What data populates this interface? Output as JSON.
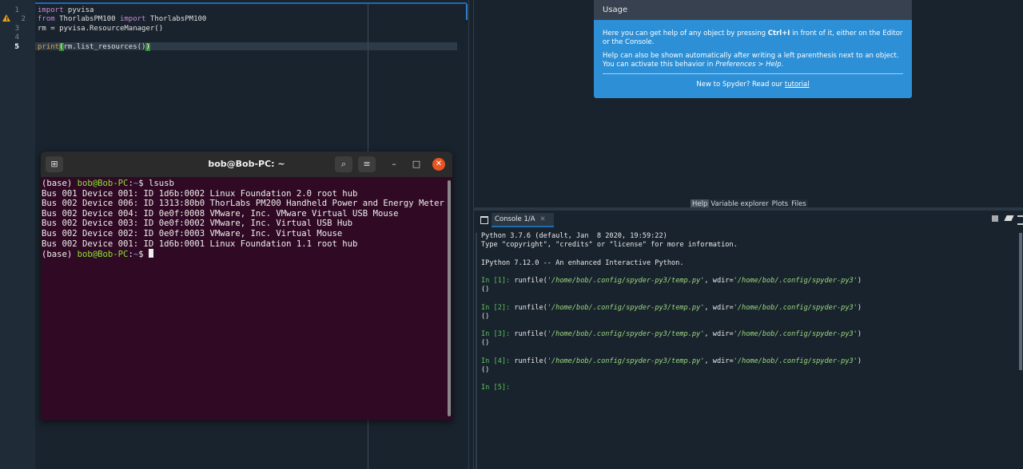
{
  "editor": {
    "line_numbers": [
      "1",
      "2",
      "3",
      "4",
      "5"
    ],
    "warning_glyph": "!",
    "lines": [
      {
        "kw1": "import",
        "t1": " pyvisa"
      },
      {
        "kw1": "from",
        "t1": " ThorlabsPM100 ",
        "kw2": "import",
        "t2": " ThorlabsPM100"
      },
      {
        "t1": "rm = pyvisa.ResourceManager()"
      },
      {
        "t1": ""
      },
      {
        "fn": "print",
        "p_open": "(",
        "mid": "rm.list_resources()",
        "p_close": ")"
      }
    ]
  },
  "terminal": {
    "title": "bob@Bob-PC: ~",
    "icon_new_tab": "⊞",
    "icon_search": "⌕",
    "icon_menu": "≡",
    "icon_minimize": "–",
    "icon_maximize": "□",
    "icon_close": "✕",
    "prompt_prefix": "(base) ",
    "prompt_user": "bob@Bob-PC",
    "prompt_sep": ":",
    "prompt_path": "~",
    "prompt_dollar": "$ ",
    "command": "lsusb",
    "output": [
      "Bus 001 Device 001: ID 1d6b:0002 Linux Foundation 2.0 root hub",
      "Bus 002 Device 006: ID 1313:80b0 ThorLabs PM200 Handheld Power and Energy Meter",
      "Bus 002 Device 004: ID 0e0f:0008 VMware, Inc. VMware Virtual USB Mouse",
      "Bus 002 Device 003: ID 0e0f:0002 VMware, Inc. Virtual USB Hub",
      "Bus 002 Device 002: ID 0e0f:0003 VMware, Inc. Virtual Mouse",
      "Bus 002 Device 001: ID 1d6b:0001 Linux Foundation 1.1 root hub"
    ]
  },
  "usage": {
    "heading": "Usage",
    "p1_a": "Here you can get help of any object by pressing ",
    "p1_b": "Ctrl+I",
    "p1_c": " in front of it, either on the Editor or the Console.",
    "p2_a": "Help can also be shown automatically after writing a left parenthesis next to an object. You can activate this behavior in ",
    "p2_b": "Preferences > Help",
    "p2_c": ".",
    "footer_text": "New to Spyder? Read our ",
    "footer_link": "tutorial"
  },
  "pane_tabs": [
    "Help",
    "Variable explorer",
    "Plots",
    "Files"
  ],
  "console": {
    "tab_label": "Console 1/A",
    "tab_close": "✕",
    "banner": [
      "Python 3.7.6 (default, Jan  8 2020, 19:59:22)",
      "Type \"copyright\", \"credits\" or \"license\" for more information.",
      "",
      "IPython 7.12.0 -- An enhanced Interactive Python."
    ],
    "cells": [
      {
        "prompt": "In [1]: ",
        "call": "runfile(",
        "arg1": "'/home/bob/.config/spyder-py3/temp.py'",
        "mid": ", wdir=",
        "arg2": "'/home/bob/.config/spyder-py3'",
        "end": ")",
        "out": "()"
      },
      {
        "prompt": "In [2]: ",
        "call": "runfile(",
        "arg1": "'/home/bob/.config/spyder-py3/temp.py'",
        "mid": ", wdir=",
        "arg2": "'/home/bob/.config/spyder-py3'",
        "end": ")",
        "out": "()"
      },
      {
        "prompt": "In [3]: ",
        "call": "runfile(",
        "arg1": "'/home/bob/.config/spyder-py3/temp.py'",
        "mid": ", wdir=",
        "arg2": "'/home/bob/.config/spyder-py3'",
        "end": ")",
        "out": "()"
      },
      {
        "prompt": "In [4]: ",
        "call": "runfile(",
        "arg1": "'/home/bob/.config/spyder-py3/temp.py'",
        "mid": ", wdir=",
        "arg2": "'/home/bob/.config/spyder-py3'",
        "end": ")",
        "out": "()"
      }
    ],
    "last_prompt": "In [5]:"
  }
}
